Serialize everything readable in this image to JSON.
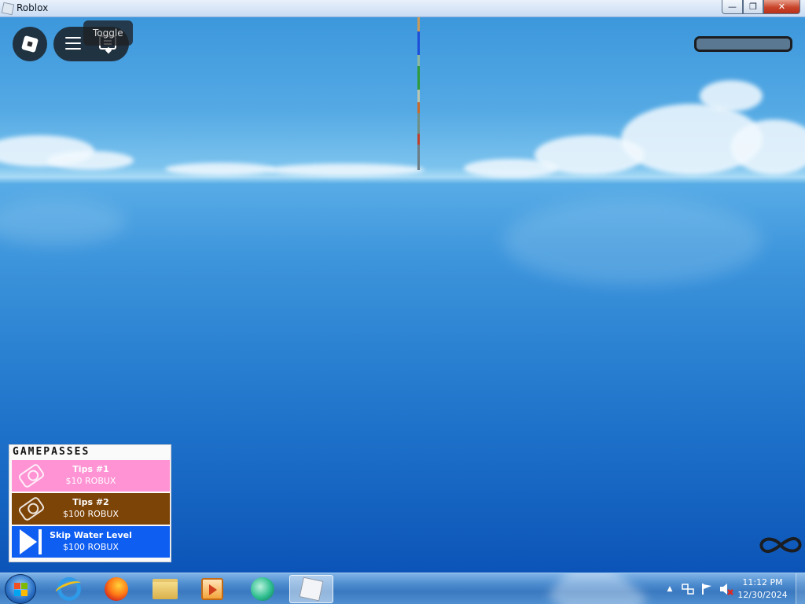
{
  "window": {
    "title": "Roblox",
    "minimize_label": "—",
    "maximize_label": "❐",
    "close_label": "✕"
  },
  "game_hud": {
    "tooltip": "Toggle",
    "health_bar_color": "#5b7893"
  },
  "gamepasses": {
    "title": "GAMEPASSES",
    "items": [
      {
        "name": "Tips #1",
        "price": "$10 ROBUX",
        "color": "#ff93d4",
        "icon": "money-icon"
      },
      {
        "name": "Tips #2",
        "price": "$100 ROBUX",
        "color": "#7d4408",
        "icon": "money-icon"
      },
      {
        "name": "Skip Water Level",
        "price": "$100 ROBUX",
        "color": "#0f5ef2",
        "icon": "skip-icon"
      }
    ]
  },
  "taskbar": {
    "pinned": [
      "internet-explorer-icon",
      "firefox-icon",
      "file-explorer-icon",
      "media-player-icon",
      "app-icon",
      "roblox-icon"
    ],
    "tray_arrow": "▲",
    "time": "11:12 PM",
    "date": "12/30/2024"
  }
}
